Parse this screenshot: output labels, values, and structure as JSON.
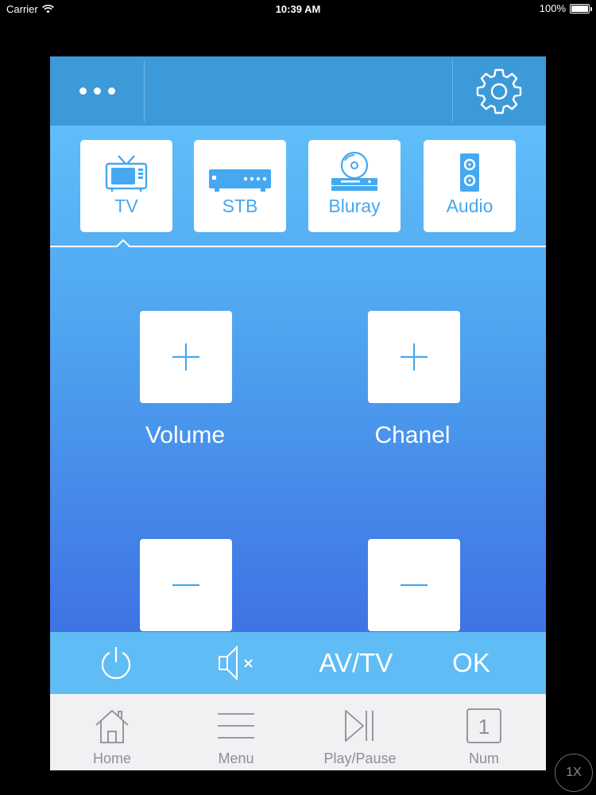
{
  "status_bar": {
    "carrier": "Carrier",
    "time": "10:39 AM",
    "battery": "100%"
  },
  "top_bar": {
    "menu_icon": "more-dots-icon",
    "settings_icon": "gear-icon"
  },
  "devices": [
    {
      "label": "TV",
      "icon": "tv-icon",
      "selected": true
    },
    {
      "label": "STB",
      "icon": "set-top-box-icon"
    },
    {
      "label": "Bluray",
      "icon": "bluray-player-icon"
    },
    {
      "label": "Audio",
      "icon": "speaker-icon"
    }
  ],
  "controls": {
    "volume_label": "Volume",
    "channel_label": "Chanel"
  },
  "action_bar": {
    "power_icon": "power-icon",
    "mute_icon": "mute-icon",
    "av_tv": "AV/TV",
    "ok": "OK"
  },
  "tab_bar": [
    {
      "label": "Home",
      "icon": "home-icon"
    },
    {
      "label": "Menu",
      "icon": "menu-lines-icon"
    },
    {
      "label": "Play/Pause",
      "icon": "play-pause-icon"
    },
    {
      "label": "Num",
      "icon": "numpad-icon",
      "glyph": "1"
    }
  ],
  "zoom_button": "1X",
  "colors": {
    "accent": "#45a8f0",
    "top_bar": "#3d9ad9",
    "action_bar": "#5fbcf5",
    "tab_bar": "#f1f1f3"
  }
}
